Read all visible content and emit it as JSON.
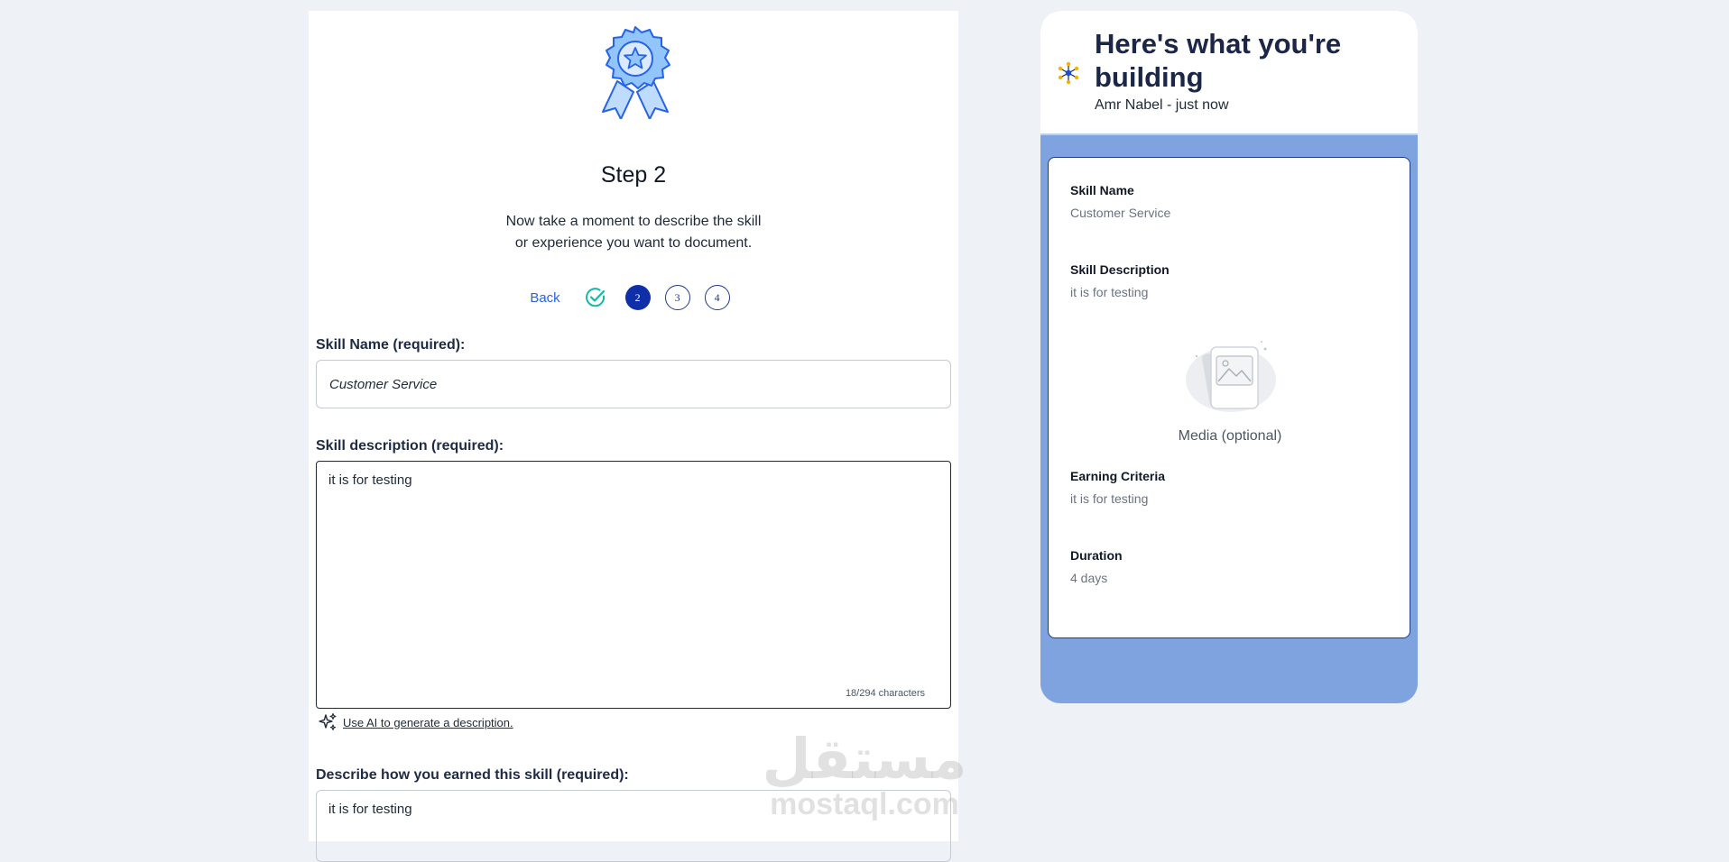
{
  "form": {
    "step_title": "Step 2",
    "step_description": "Now take a moment to describe the skill or experience you want to document.",
    "back_label": "Back",
    "steps": [
      "2",
      "3",
      "4"
    ],
    "skill_name_label": "Skill Name (required):",
    "skill_name_value": "Customer Service",
    "skill_desc_label": "Skill description (required):",
    "skill_desc_value": "it is for testing",
    "char_count": "18/294 characters",
    "ai_link": "Use AI to generate a description.",
    "earned_label": "Describe how you earned this skill (required):",
    "earned_value": "it is for testing"
  },
  "preview": {
    "title": "Here's what you're building",
    "subtitle": "Amr Nabel - just now",
    "skill_name_label": "Skill Name",
    "skill_name_value": "Customer Service",
    "skill_desc_label": "Skill Description",
    "skill_desc_value": "it is for testing",
    "media_label": "Media (optional)",
    "criteria_label": "Earning Criteria",
    "criteria_value": "it is for testing",
    "duration_label": "Duration",
    "duration_value": "4 days"
  },
  "watermark": {
    "arabic": "مستقل",
    "latin": "mostaql.com"
  },
  "colors": {
    "accent": "#0e2fa8",
    "link": "#2563eb",
    "check": "#14b8a6",
    "preview_bg": "#7ea3df",
    "heading": "#1c2747"
  },
  "icons": [
    "award-badge-icon",
    "check-circle-icon",
    "sparkles-icon",
    "network-icon",
    "image-placeholder-icon"
  ]
}
